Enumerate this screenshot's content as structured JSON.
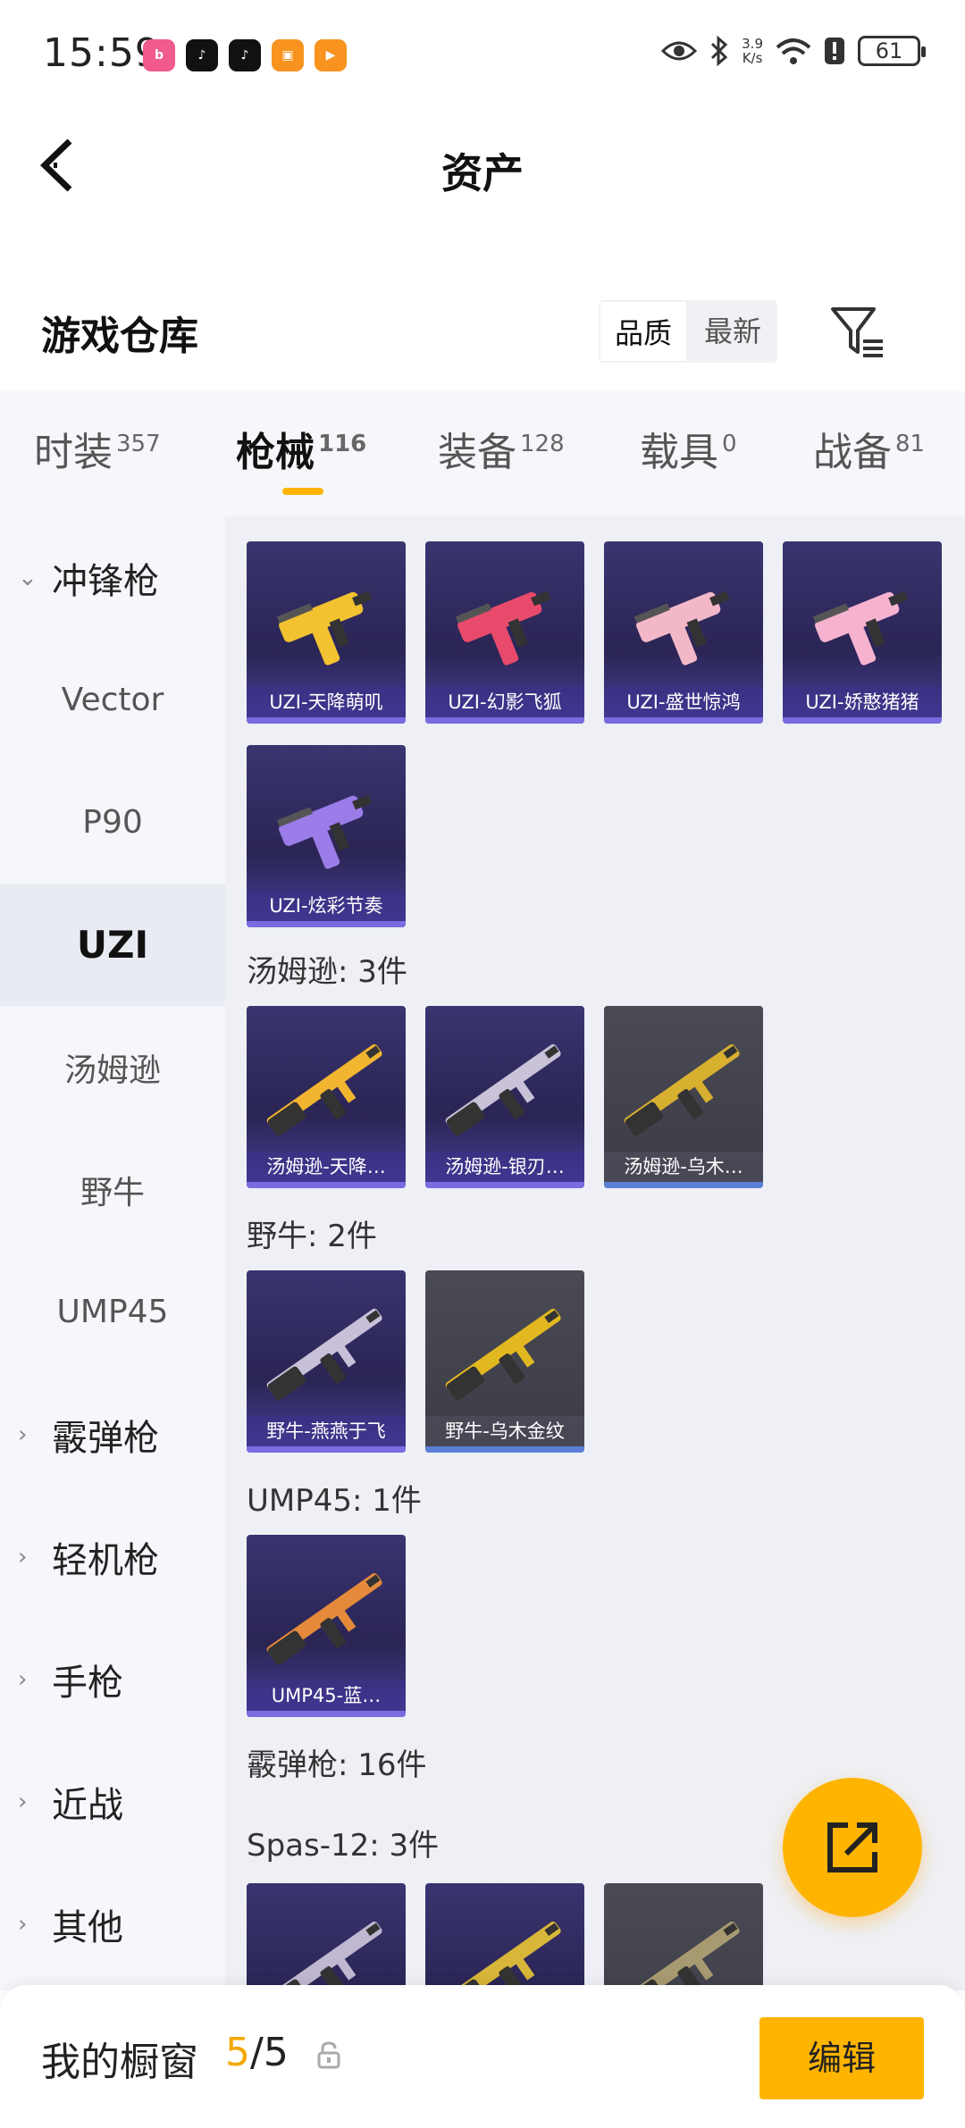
{
  "status_bar": {
    "time": "15:59",
    "network_speed": "3.9\nK/s",
    "battery": "61",
    "apps": [
      {
        "name": "bilibili-icon",
        "color": "#f05a8d",
        "glyph": "b"
      },
      {
        "name": "tiktok-icon",
        "color": "#111111",
        "glyph": "♪"
      },
      {
        "name": "tiktok-icon",
        "color": "#111111",
        "glyph": "♪"
      },
      {
        "name": "game-icon",
        "color": "#f7931e",
        "glyph": "▣"
      },
      {
        "name": "video-app-icon",
        "color": "#f7931e",
        "glyph": "▶"
      }
    ]
  },
  "header": {
    "title": "资产"
  },
  "section": {
    "title": "游戏仓库",
    "sort_options": [
      "品质",
      "最新"
    ]
  },
  "categories": [
    {
      "label": "时装",
      "count": "357"
    },
    {
      "label": "枪械",
      "count": "116"
    },
    {
      "label": "装备",
      "count": "128"
    },
    {
      "label": "载具",
      "count": "0"
    },
    {
      "label": "战备",
      "count": "81"
    }
  ],
  "sidebar": {
    "items": [
      {
        "label": "冲锋枪",
        "type": "group",
        "chev": "⌄"
      },
      {
        "label": "Vector",
        "type": "sub"
      },
      {
        "label": "P90",
        "type": "sub"
      },
      {
        "label": "UZI",
        "type": "sub"
      },
      {
        "label": "汤姆逊",
        "type": "sub"
      },
      {
        "label": "野牛",
        "type": "sub"
      },
      {
        "label": "UMP45",
        "type": "sub"
      },
      {
        "label": "霰弹枪",
        "type": "group",
        "chev": "›"
      },
      {
        "label": "轻机枪",
        "type": "group",
        "chev": "›"
      },
      {
        "label": "手枪",
        "type": "group",
        "chev": "›"
      },
      {
        "label": "近战",
        "type": "group",
        "chev": "›"
      },
      {
        "label": "其他",
        "type": "group",
        "chev": "›"
      }
    ]
  },
  "content": {
    "uzi_items": [
      "UZI-天降萌叽",
      "UZI-幻影飞狐",
      "UZI-盛世惊鸿",
      "UZI-娇憨猪猪",
      "UZI-炫彩节奏"
    ],
    "thompson_header": "汤姆逊: 3件",
    "thompson_items": [
      "汤姆逊-天降…",
      "汤姆逊-银刃…",
      "汤姆逊-乌木…"
    ],
    "bizon_header": "野牛: 2件",
    "bizon_items": [
      "野牛-燕燕于飞",
      "野牛-乌木金纹"
    ],
    "ump_header": "UMP45: 1件",
    "ump_items": [
      "UMP45-蓝…"
    ],
    "shotgun_header": "霰弹枪: 16件",
    "spas_header": "Spas-12: 3件"
  },
  "bottom_bar": {
    "label": "我的橱窗",
    "current": "5",
    "separator": "/",
    "total": "5",
    "edit_label": "编辑"
  }
}
